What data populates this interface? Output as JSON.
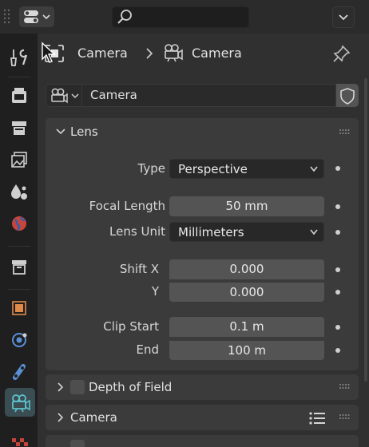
{
  "breadcrumb": {
    "object_name": "Camera",
    "data_name": "Camera"
  },
  "datablock": {
    "name": "Camera"
  },
  "lens_panel": {
    "title": "Lens",
    "type_label": "Type",
    "type_value": "Perspective",
    "focal_length_label": "Focal Length",
    "focal_length_value": "50 mm",
    "lens_unit_label": "Lens Unit",
    "lens_unit_value": "Millimeters",
    "shift_x_label": "Shift X",
    "shift_x_value": "0.000",
    "shift_y_label": "Y",
    "shift_y_value": "0.000",
    "clip_start_label": "Clip Start",
    "clip_start_value": "0.1 m",
    "clip_end_label": "End",
    "clip_end_value": "100 m"
  },
  "dof_panel": {
    "title": "Depth of Field"
  },
  "camera_panel": {
    "title": "Camera"
  },
  "colors": {
    "active_tab": "#3a4d52",
    "camera_data_icon": "#5dc1cc",
    "object_icon": "#e08a4a",
    "physics_icon": "#5a8fd6"
  }
}
